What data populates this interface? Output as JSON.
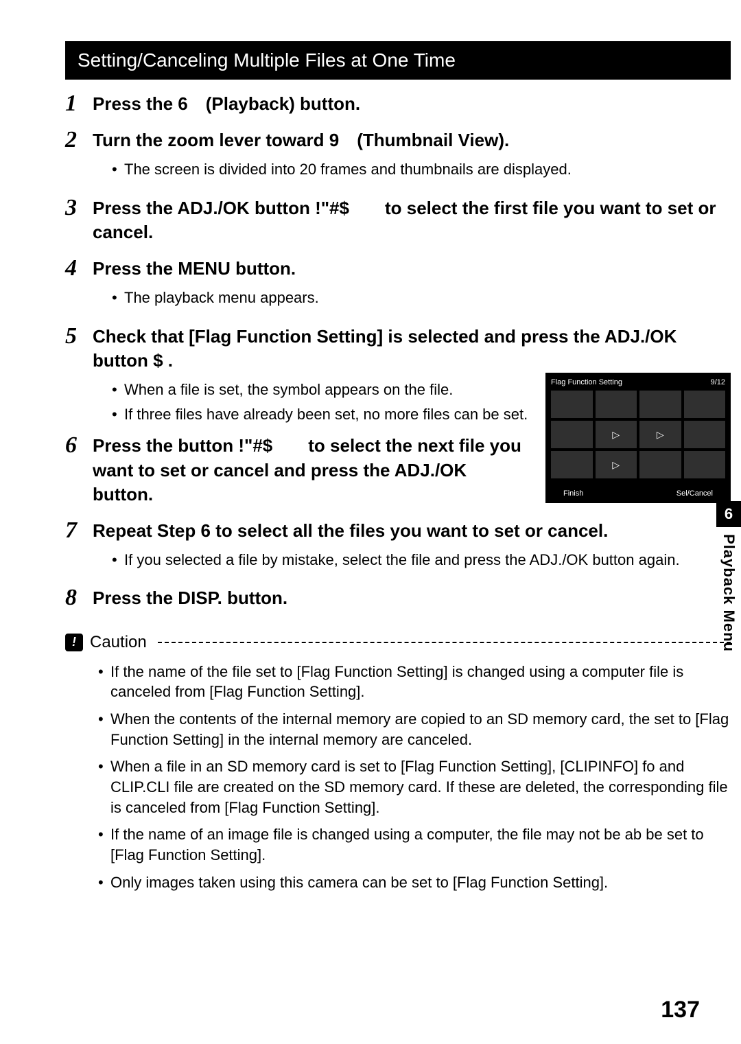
{
  "header": "Setting/Canceling Multiple Files at One Time",
  "steps": {
    "s1": {
      "num": "1",
      "title": "Press the 6 (Playback) button."
    },
    "s2": {
      "num": "2",
      "title": "Turn the zoom lever toward 9 (Thumbnail View).",
      "sub": [
        "The screen is divided into 20 frames and thumbnails are displayed."
      ]
    },
    "s3": {
      "num": "3",
      "title": "Press the ADJ./OK button !\"#$  to select the first file you want to set or cancel."
    },
    "s4": {
      "num": "4",
      "title": "Press the MENU button.",
      "sub": [
        "The playback menu appears."
      ]
    },
    "s5": {
      "num": "5",
      "title": "Check that [Flag Function Setting] is selected and press the ADJ./OK button $ .",
      "sub": [
        "When a file is set, the symbol appears on the file.",
        "If three files have already been set, no more files can be set."
      ]
    },
    "s6": {
      "num": "6",
      "title": "Press the button !\"#$  to select the next file you want to set or cancel and press the ADJ./OK button."
    },
    "s7": {
      "num": "7",
      "title": "Repeat Step 6 to select all the files you want to set or cancel.",
      "sub": [
        "If you selected a file by mistake, select the file and press the ADJ./OK button again."
      ]
    },
    "s8": {
      "num": "8",
      "title": "Press the DISP. button."
    }
  },
  "screen": {
    "title": "Flag Function Setting",
    "counter": "9/12",
    "flags": [
      false,
      false,
      false,
      false,
      false,
      true,
      true,
      false,
      false,
      true,
      false,
      false
    ],
    "finish": "Finish",
    "sel": "Sel/Cancel"
  },
  "caution": {
    "label": "Caution",
    "items": [
      "If the name of the file set to [Flag Function Setting] is changed using a computer file is canceled from [Flag Function Setting].",
      "When the contents of the internal memory are copied to an SD memory card, the set to [Flag Function Setting] in the internal memory are canceled.",
      "When a file in an SD memory card is set to [Flag Function Setting], [CLIPINFO] fo and CLIP.CLI file are created on the SD memory card. If these are deleted, the corresponding file is canceled from [Flag Function Setting].",
      "If the name of an image file is changed using a computer, the file may not be ab be set to [Flag Function Setting].",
      "Only images taken using this camera can be set to [Flag Function Setting]."
    ]
  },
  "sideTab": {
    "chapter": "6",
    "label": "Playback Menu"
  },
  "pageNumber": "137"
}
